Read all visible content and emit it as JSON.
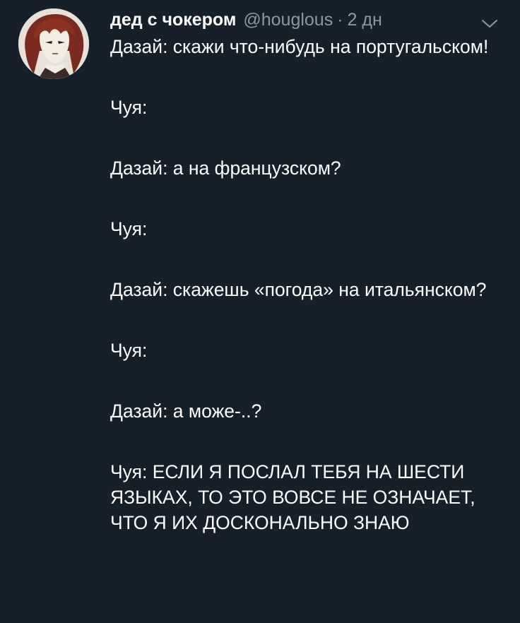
{
  "colors": {
    "background": "#15202b",
    "text_primary": "#ffffff",
    "text_secondary": "#8899a6"
  },
  "tweet": {
    "author_name": "дед с чокером",
    "author_handle": "@houglous",
    "separator": "·",
    "timestamp": "2 дн",
    "menu_icon": "chevron-down-icon",
    "avatar_icon": "anime-character-avatar",
    "paragraphs": [
      "Дазай: скажи что-нибудь на португальском!",
      "Чуя:",
      "Дазай: а на французском?",
      "Чуя:",
      "Дазай: скажешь «погода» на итальянском?",
      "Чуя:",
      "Дазай: а може-..?",
      "Чуя: ЕСЛИ Я ПОСЛАЛ ТЕБЯ НА ШЕСТИ ЯЗЫКАХ, ТО ЭТО ВОВСЕ НЕ ОЗНАЧАЕТ, ЧТО Я ИХ ДОСКОНАЛЬНО ЗНАЮ"
    ]
  }
}
